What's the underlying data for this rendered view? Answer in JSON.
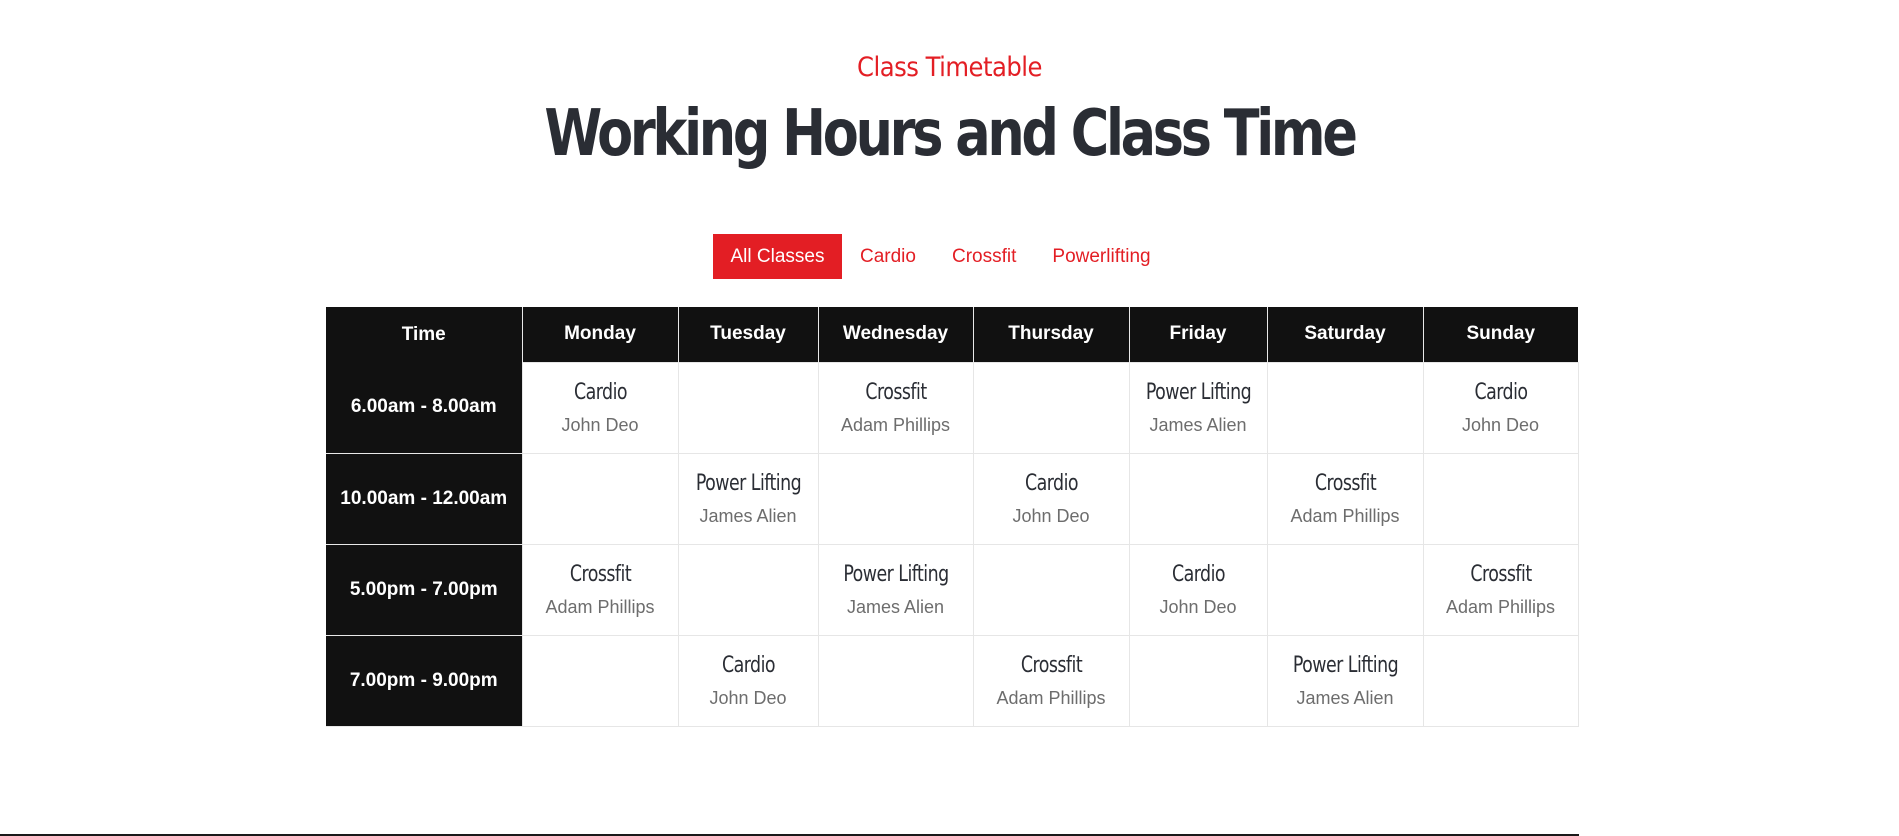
{
  "header": {
    "subtitle": "Class Timetable",
    "title": "Working Hours and Class Time"
  },
  "filters": [
    {
      "label": "All Classes",
      "active": true
    },
    {
      "label": "Cardio",
      "active": false
    },
    {
      "label": "Crossfit",
      "active": false
    },
    {
      "label": "Powerlifting",
      "active": false
    }
  ],
  "colors": {
    "accent": "#e31e24",
    "header_bg": "#111111",
    "title": "#2a2d34",
    "trainer": "#6d6d6d"
  },
  "timetable": {
    "columns": [
      "Time",
      "Monday",
      "Tuesday",
      "Wednesday",
      "Thursday",
      "Friday",
      "Saturday",
      "Sunday"
    ],
    "rows": [
      {
        "time": "6.00am - 8.00am",
        "slots": [
          {
            "class": "Cardio",
            "trainer": "John Deo"
          },
          {
            "class": "",
            "trainer": ""
          },
          {
            "class": "Crossfit",
            "trainer": "Adam Phillips"
          },
          {
            "class": "",
            "trainer": ""
          },
          {
            "class": "Power Lifting",
            "trainer": "James Alien"
          },
          {
            "class": "",
            "trainer": ""
          },
          {
            "class": "Cardio",
            "trainer": "John Deo"
          }
        ]
      },
      {
        "time": "10.00am - 12.00am",
        "slots": [
          {
            "class": "",
            "trainer": ""
          },
          {
            "class": "Power Lifting",
            "trainer": "James Alien"
          },
          {
            "class": "",
            "trainer": ""
          },
          {
            "class": "Cardio",
            "trainer": "John Deo"
          },
          {
            "class": "",
            "trainer": ""
          },
          {
            "class": "Crossfit",
            "trainer": "Adam Phillips"
          },
          {
            "class": "",
            "trainer": ""
          }
        ]
      },
      {
        "time": "5.00pm - 7.00pm",
        "slots": [
          {
            "class": "Crossfit",
            "trainer": "Adam Phillips"
          },
          {
            "class": "",
            "trainer": ""
          },
          {
            "class": "Power Lifting",
            "trainer": "James Alien"
          },
          {
            "class": "",
            "trainer": ""
          },
          {
            "class": "Cardio",
            "trainer": "John Deo"
          },
          {
            "class": "",
            "trainer": ""
          },
          {
            "class": "Crossfit",
            "trainer": "Adam Phillips"
          }
        ]
      },
      {
        "time": "7.00pm - 9.00pm",
        "slots": [
          {
            "class": "",
            "trainer": ""
          },
          {
            "class": "Cardio",
            "trainer": "John Deo"
          },
          {
            "class": "",
            "trainer": ""
          },
          {
            "class": "Crossfit",
            "trainer": "Adam Phillips"
          },
          {
            "class": "",
            "trainer": ""
          },
          {
            "class": "Power Lifting",
            "trainer": "James Alien"
          },
          {
            "class": "",
            "trainer": ""
          }
        ]
      }
    ]
  }
}
